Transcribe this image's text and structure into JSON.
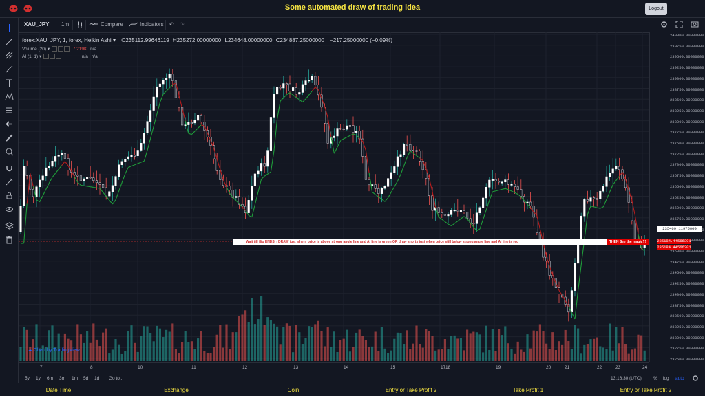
{
  "page": {
    "title": "Some automated draw of trading idea",
    "logout_label": "Logout",
    "colors": {
      "title": "#f5e342",
      "up": "#ffffff",
      "down": "#d32f2f",
      "ai_green": "#1f9d3a",
      "ai_red": "#b71c1c",
      "volume_up": "#26a69a",
      "volume_down": "#ef5350"
    }
  },
  "header": {
    "symbol": "XAU_JPY",
    "interval": "1m",
    "compare_label": "Compare",
    "indicators_label": "Indicators"
  },
  "legend": {
    "series_title": "forex:XAU_JPY, 1, forex, Heikin Ashi",
    "open": "O235112.99646119",
    "high": "H235272.00000000",
    "low": "L234648.00000000",
    "close": "C234887.25000000",
    "change": "−217.25000000 (−0.09%)",
    "volume_label": "Volume (20)",
    "volume_value": "7.219K",
    "volume_na": "n/a",
    "ai_label": "AI (1, 1)",
    "ai_na1": "n/a",
    "ai_na2": "n/a"
  },
  "banner": {
    "text": "Wait till flip ENDS  ↑   DRAW just when:  price is above strong angle line and AI line is green        OR        draw shorts just when price still below strong angle line and AI line is red",
    "magic": "THEN See the magic?!"
  },
  "price_axis": {
    "labels": [
      "240000.00000000",
      "239750.00000000",
      "239500.00000000",
      "239250.00000000",
      "239000.00000000",
      "238750.00000000",
      "238500.00000000",
      "238250.00000000",
      "238000.00000000",
      "237750.00000000",
      "237500.00000000",
      "237250.00000000",
      "237000.00000000",
      "236750.00000000",
      "236500.00000000",
      "236250.00000000",
      "236000.00000000",
      "235750.00000000",
      "235500.00000000",
      "235250.00000000",
      "235000.00000000",
      "234750.00000000",
      "234500.00000000",
      "234250.00000000",
      "234000.00000000",
      "233750.00000000",
      "233500.00000000",
      "233250.00000000",
      "233000.00000000",
      "232750.00000000",
      "232500.00000000"
    ],
    "tag_white": "235469.11975000",
    "tag_red_1": "235184.44566301",
    "tag_red_2": "235184.44566301"
  },
  "time_axis": {
    "labels": [
      "7",
      "8",
      "10",
      "11",
      "12",
      "13",
      "14",
      "15",
      "17",
      "18",
      "19",
      "20",
      "21",
      "22",
      "23",
      "24"
    ]
  },
  "bottom_bar": {
    "ranges": [
      "5y",
      "1y",
      "6m",
      "3m",
      "1m",
      "5d",
      "1d"
    ],
    "goto": "Go to...",
    "time": "13:16:30 (UTC)",
    "pct": "%",
    "log": "log",
    "auto": "auto"
  },
  "watermark": "Chart by TradingView",
  "footer": {
    "labels": [
      "Date Time",
      "Exchange",
      "Coin",
      "Entry or Take Profit 2",
      "Take Profit 1",
      "Entry or Take Profit 2"
    ]
  }
}
